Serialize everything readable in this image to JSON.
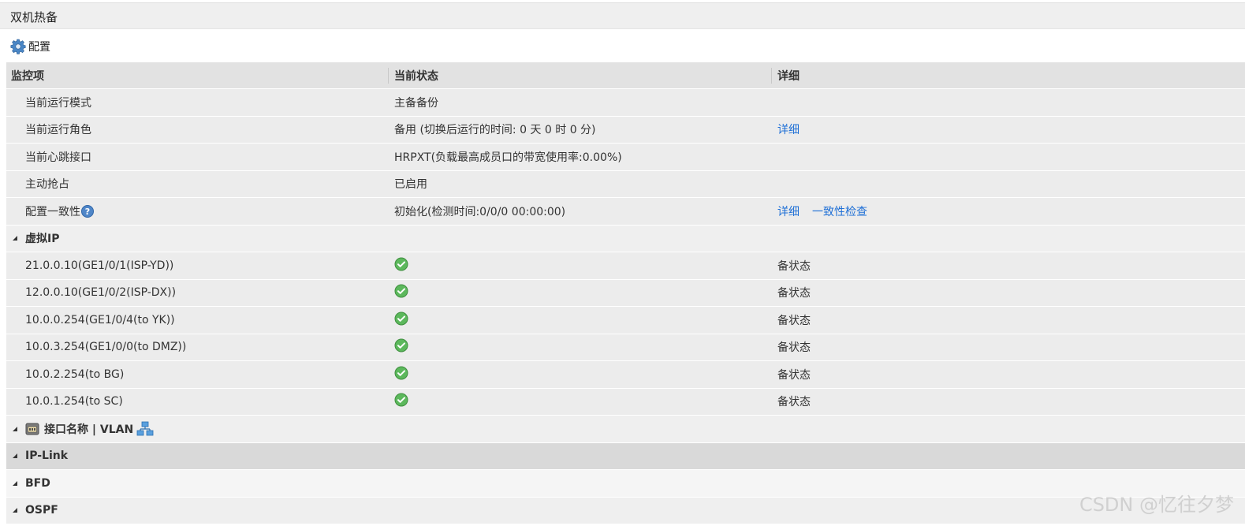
{
  "title": "双机热备",
  "toolbar": {
    "config_label": "配置"
  },
  "table": {
    "headers": [
      "监控项",
      "当前状态",
      "详细"
    ],
    "rows": [
      {
        "item": "当前运行模式",
        "status": "主备备份",
        "links": []
      },
      {
        "item": "当前运行角色",
        "status": "备用 (切换后运行的时间: 0 天 0 时 0 分)",
        "links": [
          "详细"
        ]
      },
      {
        "item": "当前心跳接口",
        "status": "HRPXT(负载最高成员口的带宽使用率:0.00%)",
        "links": []
      },
      {
        "item": "主动抢占",
        "status": "已启用",
        "links": []
      },
      {
        "item": "配置一致性",
        "help": "?",
        "status": "初始化(检测时间:0/0/0 00:00:00)",
        "links": [
          "详细",
          "一致性检查"
        ]
      }
    ],
    "virtual_ip": {
      "label": "虚拟IP",
      "entries": [
        {
          "ip": "21.0.0.10(GE1/0/1(ISP-YD))",
          "state": "备状态"
        },
        {
          "ip": "12.0.0.10(GE1/0/2(ISP-DX))",
          "state": "备状态"
        },
        {
          "ip": "10.0.0.254(GE1/0/4(to YK))",
          "state": "备状态"
        },
        {
          "ip": "10.0.3.254(GE1/0/0(to DMZ))",
          "state": "备状态"
        },
        {
          "ip": "10.0.2.254(to BG)",
          "state": "备状态"
        },
        {
          "ip": "10.0.1.254(to SC)",
          "state": "备状态"
        }
      ]
    },
    "sections": [
      {
        "label": "接口名称 | VLAN",
        "variant": "normal",
        "icons": true
      },
      {
        "label": "IP-Link",
        "variant": "dark"
      },
      {
        "label": "BFD",
        "variant": "light"
      },
      {
        "label": "OSPF",
        "variant": "normal"
      }
    ]
  },
  "watermark": "CSDN @忆往夕梦",
  "colors": {
    "link": "#1e6fd6",
    "ok": "#5cb85c",
    "header_bg": "#e2e2e2",
    "row_bg": "#ececec"
  }
}
